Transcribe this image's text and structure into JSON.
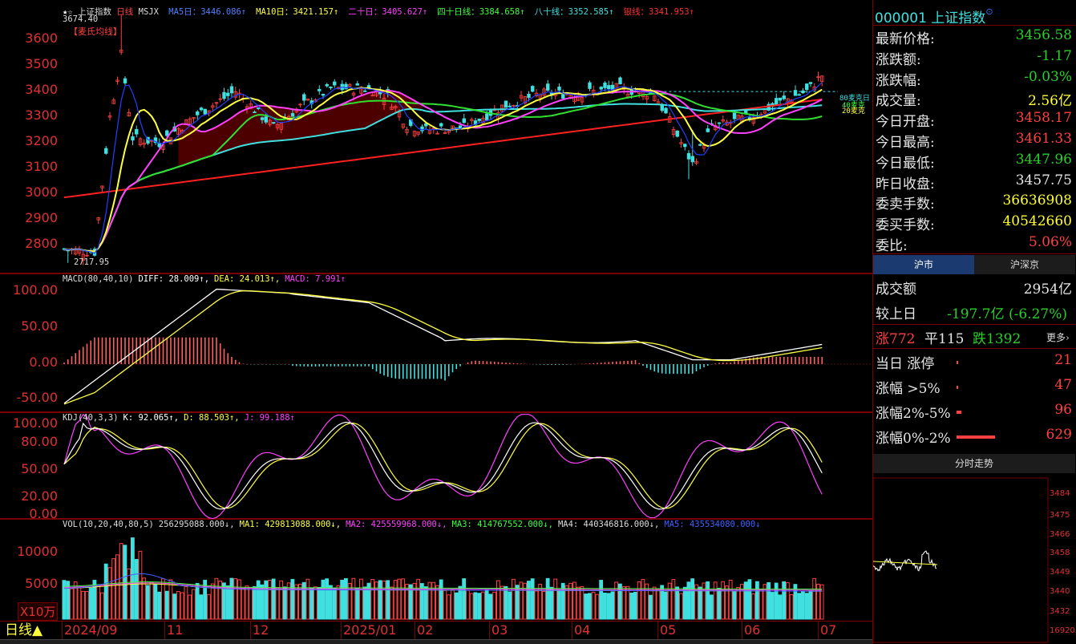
{
  "main": {
    "title_stars": "★☆",
    "title": "上证指数",
    "period": "日线",
    "indicator_name": "MSJX",
    "ma_items": [
      {
        "label": "MA5日：3446.086↑",
        "color": "#5080ff"
      },
      {
        "label": "MA10日：3421.157↑",
        "color": "#ffff40"
      },
      {
        "label": "二十日：3405.627↑",
        "color": "#ff40ff"
      },
      {
        "label": "四十日线：3384.658↑",
        "color": "#40ff40"
      },
      {
        "label": "八十线：3352.585↑",
        "color": "#40e0e0"
      },
      {
        "label": "银线：3341.953↑",
        "color": "#ff3030"
      }
    ],
    "high_label": "3674.40",
    "low_label": "2717.95",
    "sub_legend": "【麦氏均线】",
    "y_ticks": [
      "3600",
      "3500",
      "3400",
      "3300",
      "3200",
      "3100",
      "3000",
      "2900",
      "2800"
    ],
    "right_tags": [
      "80麦克日",
      "40麦克",
      "20麦克"
    ]
  },
  "macd": {
    "legend": [
      {
        "label": "MACD(80,40,10)",
        "color": "#dddddd"
      },
      {
        "label": "DIFF: 28.009↑,",
        "color": "#ffffff"
      },
      {
        "label": "DEA: 24.013↑,",
        "color": "#ffff40"
      },
      {
        "label": "MACD: 7.991↑",
        "color": "#ff40ff"
      }
    ],
    "y_ticks": [
      "100.00",
      "50.00",
      "0.00",
      "-50.00"
    ]
  },
  "kdj": {
    "legend": [
      {
        "label": "KDJ(40,3,3)",
        "color": "#dddddd"
      },
      {
        "label": "K: 92.065↑,",
        "color": "#ffffff"
      },
      {
        "label": "D: 88.503↑,",
        "color": "#ffff40"
      },
      {
        "label": "J: 99.188↑",
        "color": "#ff40ff"
      }
    ],
    "y_ticks": [
      "100.00",
      "80.00",
      "50.00",
      "20.00",
      "0.00"
    ]
  },
  "vol": {
    "legend": [
      {
        "label": "VOL(10,20,40,80,5)",
        "color": "#dddddd"
      },
      {
        "label": "256295088.000↓,",
        "color": "#dddddd"
      },
      {
        "label": "MA1: 429813088.000↓,",
        "color": "#ffff40"
      },
      {
        "label": "MA2: 425559968.000↓,",
        "color": "#ff40ff"
      },
      {
        "label": "MA3: 414767552.000↓,",
        "color": "#40ff40"
      },
      {
        "label": "MA4: 440346816.000↓,",
        "color": "#dddddd"
      },
      {
        "label": "MA5: 435534080.000↓",
        "color": "#4060ff"
      }
    ],
    "y_ticks": [
      "10000",
      "5000"
    ],
    "unit": "X10万"
  },
  "xaxis": {
    "labels": [
      "2024/09",
      "11",
      "12",
      "2025/01",
      "02",
      "03",
      "04",
      "05",
      "06",
      "07"
    ]
  },
  "bottom": {
    "period_label": "日线▲"
  },
  "quote": {
    "code_title": "000001 上证指数",
    "badge": "⊙",
    "rows": [
      {
        "k": "最新价格:",
        "v": "3456.58",
        "c": "g"
      },
      {
        "k": "涨跌额:",
        "v": "-1.17",
        "c": "g"
      },
      {
        "k": "涨跌幅:",
        "v": "-0.03%",
        "c": "g"
      },
      {
        "k": "成交量:",
        "v": "2.56亿",
        "c": "y"
      },
      {
        "k": "今日开盘:",
        "v": "3458.17",
        "c": "r"
      },
      {
        "k": "今日最高:",
        "v": "3461.33",
        "c": "r"
      },
      {
        "k": "今日最低:",
        "v": "3447.96",
        "c": "g"
      },
      {
        "k": "昨日收盘:",
        "v": "3457.75",
        "c": "w"
      },
      {
        "k": "委卖手数:",
        "v": "36636908",
        "c": "y"
      },
      {
        "k": "委买手数:",
        "v": "40542660",
        "c": "y"
      },
      {
        "k": "委比:",
        "v": "5.06%",
        "c": "r"
      }
    ],
    "tabs": [
      "沪市",
      "沪深京"
    ],
    "turnover_label": "成交额",
    "turnover": "2954亿",
    "vs_label": "较上日",
    "vs_value": "-197.7亿 (-6.27%)",
    "up_label": "涨772",
    "flat_label": "平115",
    "down_label": "跌1392",
    "more": "更多",
    "stats": [
      {
        "k": "当日 涨停",
        "v": "21",
        "frac": 0.03
      },
      {
        "k": "涨幅 >5%",
        "v": "47",
        "frac": 0.05
      },
      {
        "k": "涨幅2%-5%",
        "v": "96",
        "frac": 0.12
      },
      {
        "k": "涨幅0%-2%",
        "v": "629",
        "frac": 1.0
      }
    ],
    "intraday_title": "分时走势",
    "intraday_ticks": [
      "3484",
      "3475",
      "3466",
      "3458",
      "3449",
      "3440",
      "3432",
      "16920"
    ]
  },
  "colors": {
    "up": "#ff4040",
    "down": "#40e0e0",
    "axis": "#7a0000"
  }
}
